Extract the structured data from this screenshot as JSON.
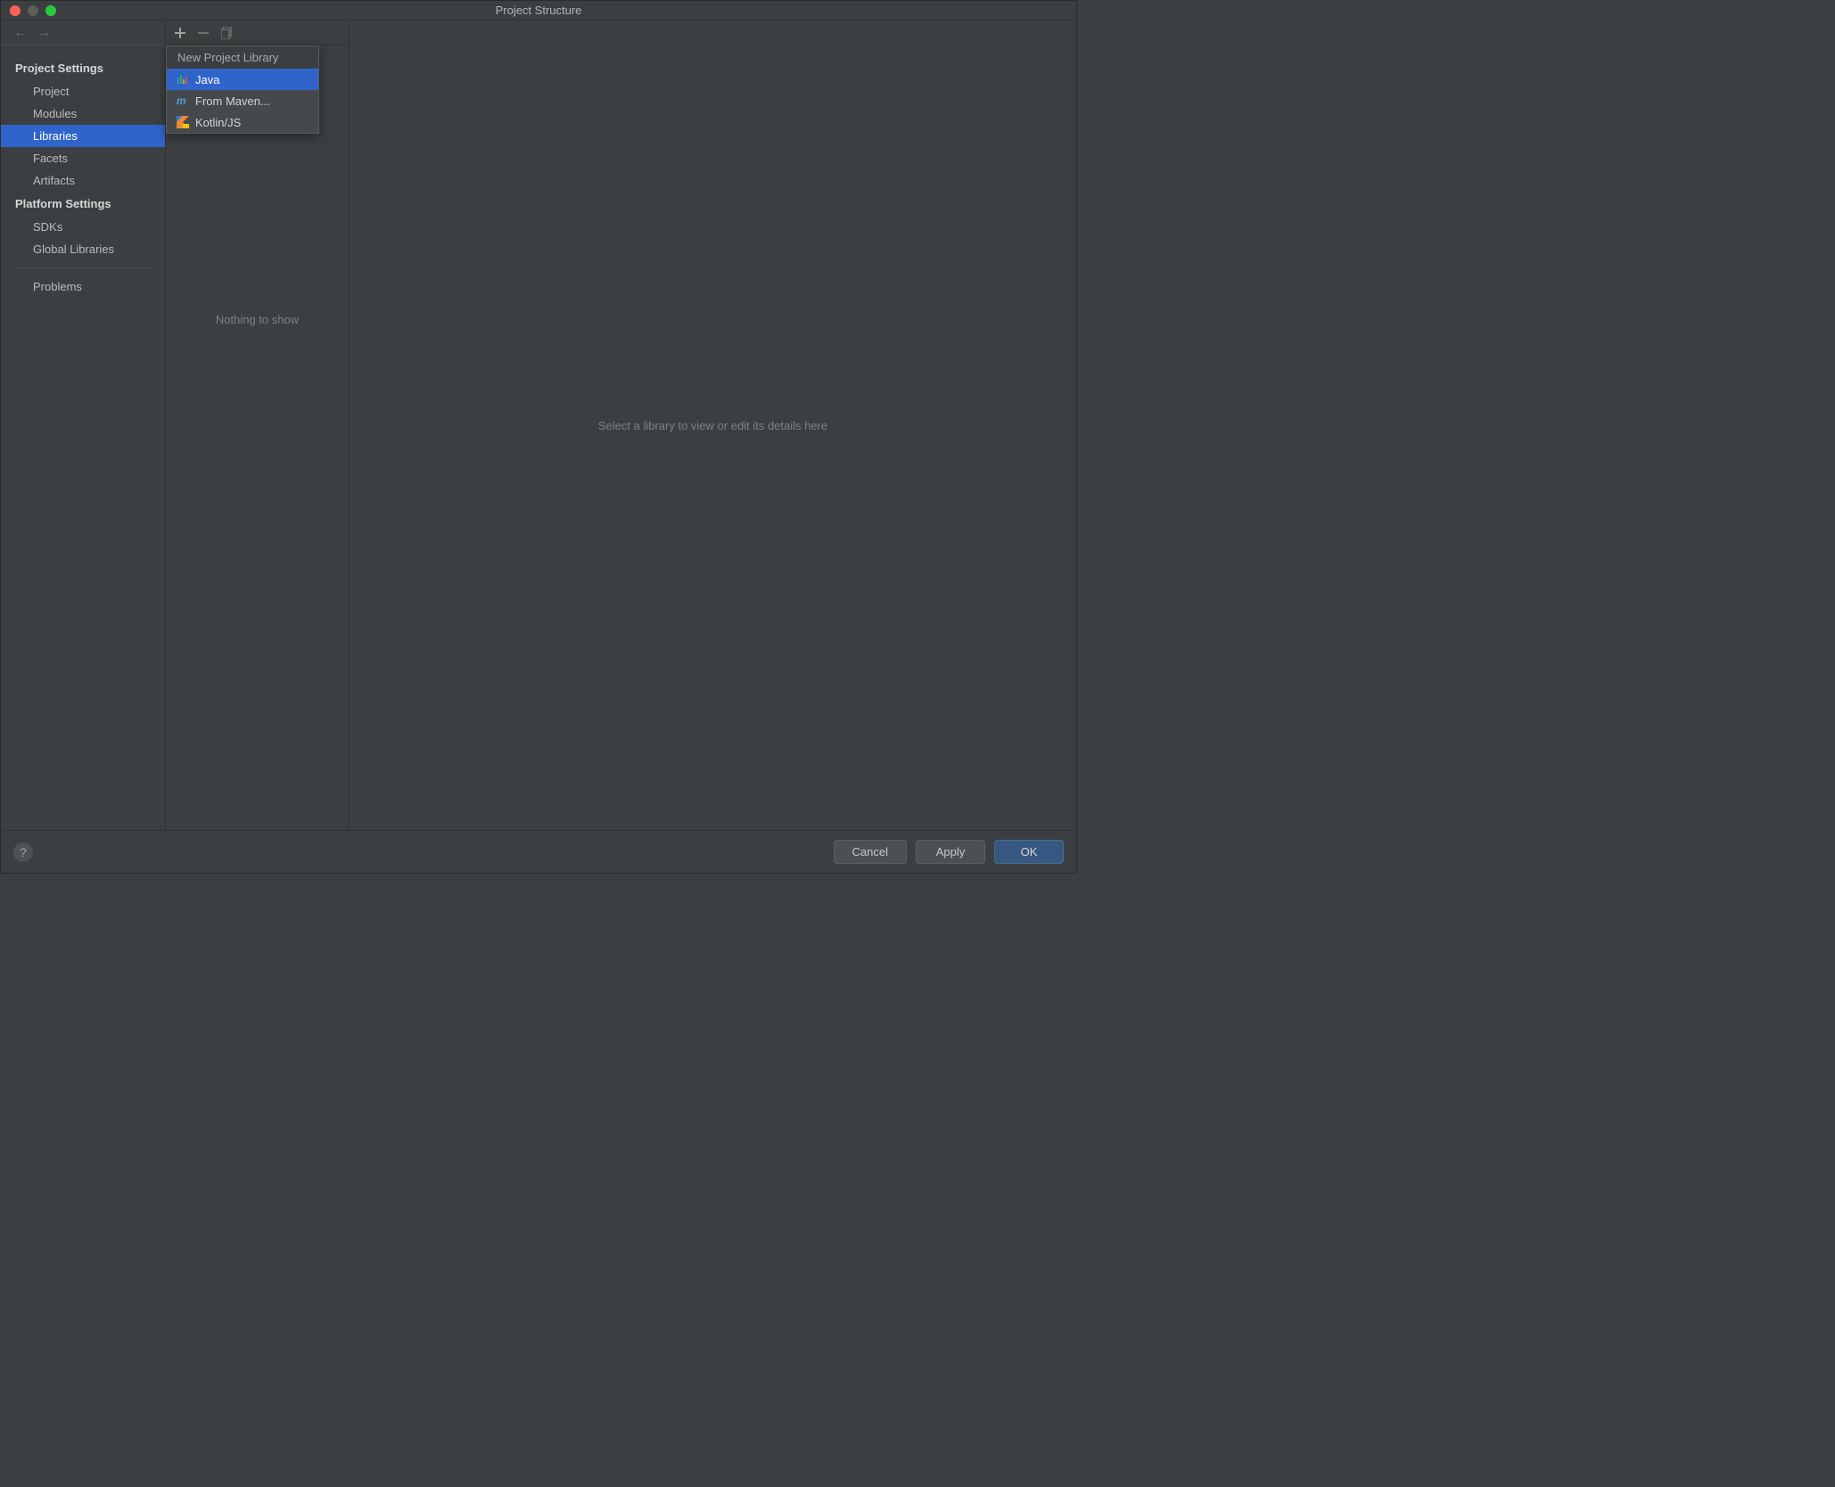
{
  "title": "Project Structure",
  "sidebar": {
    "section1_header": "Project Settings",
    "section1_items": [
      "Project",
      "Modules",
      "Libraries",
      "Facets",
      "Artifacts"
    ],
    "selected_item": "Libraries",
    "section2_header": "Platform Settings",
    "section2_items": [
      "SDKs",
      "Global Libraries"
    ],
    "problems_label": "Problems"
  },
  "middle_panel": {
    "empty_text": "Nothing to show"
  },
  "popup": {
    "header": "New Project Library",
    "items": [
      {
        "label": "Java",
        "selected": true
      },
      {
        "label": "From Maven...",
        "selected": false
      },
      {
        "label": "Kotlin/JS",
        "selected": false
      }
    ]
  },
  "right_panel": {
    "placeholder": "Select a library to view or edit its details here"
  },
  "footer": {
    "cancel": "Cancel",
    "apply": "Apply",
    "ok": "OK"
  }
}
